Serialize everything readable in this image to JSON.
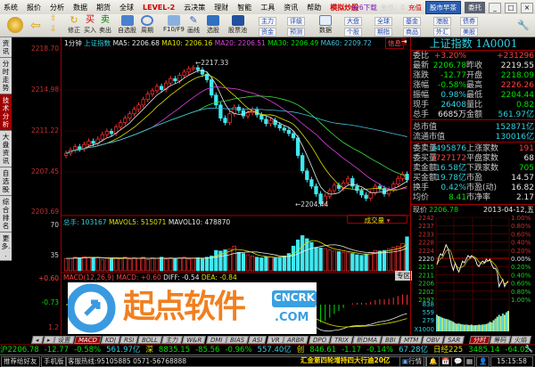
{
  "menu": {
    "items": [
      "系统",
      "报价",
      "分析",
      "数据",
      "期货",
      "全球",
      "LEVEL-2",
      "云决策",
      "理财",
      "智能",
      "工具",
      "资讯",
      "帮助",
      "模拟炒股"
    ],
    "download": "py6下载",
    "coins": "金币：0",
    "recharge": "充值",
    "morning_tea": "股市早茶",
    "entrust": "委托",
    "min": "_",
    "max": "□",
    "close": "×"
  },
  "toolbar": {
    "fix": "修正",
    "buy": "买入",
    "sell": "卖出",
    "buy_icon": "买",
    "sell_icon": "卖",
    "watchlist": "自选股",
    "period": "周期",
    "f10": "F10/F9",
    "draw": "画线",
    "pick": "选股",
    "pool": "股票池",
    "small": [
      [
        "主力",
        "资金"
      ],
      [
        "评级",
        "预测"
      ],
      [
        "大盘",
        "个股"
      ],
      [
        "全球",
        "期指"
      ],
      [
        "基金",
        "商品"
      ],
      [
        "港股",
        "外汇"
      ],
      [
        "债券",
        "美股"
      ]
    ],
    "data": "数据"
  },
  "sidebar": {
    "tabs": [
      "资讯",
      "分时走势",
      "技术分析",
      "大盘资讯",
      "自选股",
      "综合排名",
      "更多.."
    ],
    "active": 2
  },
  "chart": {
    "header": {
      "period": "1分钟",
      "name": "上证指数",
      "ma5": "MA5: 2206.68",
      "ma10": "MA10: 2206.16",
      "ma20": "MA20: 2206.51",
      "ma30": "MA30: 2206.49",
      "ma60": "MA60: 2209.72",
      "info": "信息"
    },
    "price_ticks": [
      "2218.70",
      "2214.98",
      "2211.22",
      "2207.45",
      "2203.69"
    ],
    "high_label": "2217.33",
    "low_label": "2204.44",
    "ylim": [
      2203.69,
      2218.7
    ],
    "closes": [
      2209.2,
      2209.5,
      2209.8,
      2209.6,
      2210.0,
      2210.3,
      2210.1,
      2210.5,
      2210.9,
      2211.2,
      2211.0,
      2211.6,
      2212.0,
      2212.4,
      2212.8,
      2213.2,
      2213.6,
      2214.1,
      2214.6,
      2214.9,
      2215.3,
      2215.0,
      2215.6,
      2216.0,
      2215.8,
      2216.3,
      2216.6,
      2216.9,
      2217.0,
      2216.8,
      2216.4,
      2215.9,
      2214.5,
      2213.6,
      2212.4,
      2212.0,
      2212.8,
      2213.4,
      2213.1,
      2212.6,
      2212.9,
      2213.2,
      2212.7,
      2212.3,
      2211.9,
      2212.2,
      2211.8,
      2211.5,
      2211.3,
      2211.0,
      2210.6,
      2209.0,
      2207.6,
      2206.8,
      2206.2,
      2205.5,
      2204.6,
      2205.3,
      2205.8,
      2206.3,
      2206.0,
      2206.5,
      2206.9,
      2206.2,
      2205.8,
      2205.4,
      2205.1,
      2205.6,
      2206.2,
      2206.0,
      2205.5,
      2205.9,
      2206.4,
      2206.9,
      2207.3,
      2206.78
    ],
    "volume": {
      "header_total": "总手: 103167",
      "mavol5": "MAVOL5: 515071",
      "mavol10": "MAVOL10: 478870",
      "selector": "成交量",
      "ticks": [
        "70",
        "35"
      ],
      "ymax": 75,
      "values": [
        20,
        20,
        22,
        21,
        23,
        22,
        21,
        22,
        18,
        20,
        19,
        21,
        20,
        22,
        19,
        21,
        20,
        22,
        18,
        21,
        20,
        22,
        19,
        21,
        20,
        21,
        22,
        19,
        20,
        21,
        20,
        22,
        24,
        33,
        32,
        34,
        35,
        40,
        30,
        28,
        26,
        24,
        22,
        21,
        23,
        22,
        21,
        22,
        24,
        28,
        40,
        50,
        57,
        52,
        46,
        38,
        37,
        36,
        34,
        32,
        31,
        30,
        29,
        28,
        26,
        25,
        27,
        30,
        33,
        32,
        33,
        35,
        38,
        40,
        44,
        55
      ]
    },
    "macd": {
      "header": "MACD(12,26,9)",
      "macd": "MACD: +0.60",
      "diff": "DIFF: -0.54",
      "dea": "DEA: -0.84",
      "ticks": [
        "+0.60",
        "-0.73",
        "1.2"
      ]
    },
    "expand": "专区",
    "colors": {
      "up": "#ff3030",
      "down": "#40e8f0",
      "ma5": "#e8e8e8",
      "ma10": "#e0e000",
      "ma20": "#e040e0",
      "ma30": "#40e040",
      "ma60": "#40c0e0"
    }
  },
  "quote": {
    "title": "上证指数 1A0001",
    "rows": [
      {
        "l": "委比",
        "v": "+3.20%",
        "vc": "r",
        "r": "+231296",
        "rc": "r"
      },
      {
        "l": "最新",
        "v": "2206.78",
        "vc": "g",
        "l2": "昨收",
        "r": "2219.55",
        "rc": "w"
      },
      {
        "l": "涨跌",
        "v": "-12.77",
        "vc": "g",
        "l2": "开盘",
        "r": "2218.09",
        "rc": "g"
      },
      {
        "l": "涨幅",
        "v": "-0.58%",
        "vc": "g",
        "l2": "最高",
        "r": "2226.26",
        "rc": "r"
      },
      {
        "l": "振幅",
        "v": "0.98%",
        "vc": "c",
        "l2": "最低",
        "r": "2204.44",
        "rc": "g"
      },
      {
        "l": "现手",
        "v": "26408",
        "vc": "c",
        "l2": "量比",
        "r": "0.82",
        "rc": "g"
      },
      {
        "l": "总手",
        "v": "6685万",
        "vc": "w",
        "l2": "金额",
        "r": "561.97亿",
        "rc": "c"
      },
      {
        "l": "总市值",
        "v": "",
        "vc": "w",
        "r": "152871亿",
        "rc": "c"
      },
      {
        "l": "流通市值",
        "v": "",
        "vc": "w",
        "r": "130016亿",
        "rc": "c"
      },
      {
        "l": "委卖量",
        "v": "3495876",
        "vc": "c",
        "l2": "上涨家数",
        "r": "191",
        "rc": "r"
      },
      {
        "l": "委买量",
        "v": "3727172",
        "vc": "r",
        "l2": "平盘家数",
        "r": "68",
        "rc": "w"
      },
      {
        "l": "卖金额",
        "v": "16.58亿",
        "vc": "c",
        "l2": "下跌家数",
        "r": "705",
        "rc": "g"
      },
      {
        "l": "买金额",
        "v": "19.78亿",
        "vc": "c",
        "l2": "市盈",
        "r": "14.57",
        "rc": "w"
      },
      {
        "l": "换手",
        "v": "0.42%",
        "vc": "c",
        "l2": "市盈(动)",
        "r": "16.82",
        "rc": "w"
      },
      {
        "l": "均价",
        "v": "8.41",
        "vc": "g",
        "l2": "市净率",
        "r": "2.17",
        "rc": "w"
      }
    ],
    "now_label": "现价",
    "now_value": "2206.78",
    "date": "2013-04-12,五"
  },
  "intraday": {
    "price_ticks": [
      "2242",
      "2237",
      "2233",
      "2228",
      "2224",
      "2220",
      "2215",
      "2211",
      "2206",
      "2202",
      "2197"
    ],
    "pct_ticks": [
      "1.00%",
      "0.80%",
      "0.60%",
      "0.40%",
      "0.20%",
      "0.00%",
      "0.20%",
      "0.40%",
      "0.60%",
      "0.80%",
      "1.00%"
    ],
    "vol_ticks": [
      "838",
      "559",
      "279",
      "X1000"
    ],
    "ylim": [
      2197,
      2242
    ],
    "prices": [
      2216,
      2220,
      2222,
      2221,
      2224,
      2227,
      2225,
      2221,
      2216,
      2213,
      2217,
      2214,
      2212,
      2215,
      2218,
      2217,
      2219,
      2221,
      2220,
      2221,
      2220,
      2219,
      2216,
      2215,
      2217,
      2218,
      2217,
      2219,
      2218,
      2219,
      2216,
      2214,
      2214,
      2212,
      2204,
      2206,
      2208,
      2204,
      2206,
      2207
    ],
    "volumes": [
      520,
      480,
      460,
      430,
      410,
      390,
      380,
      350,
      330,
      300,
      260,
      240,
      250,
      230,
      220,
      210,
      215,
      205,
      200,
      210,
      190,
      195,
      200,
      210,
      205,
      215,
      220,
      230,
      260,
      300,
      280,
      350,
      400,
      460,
      520,
      480,
      560,
      520,
      600,
      640
    ]
  },
  "bottom_tabs": {
    "settings": "设置",
    "items": [
      "MACD",
      "KDJ",
      "RSI",
      "BOLL",
      "主力",
      "W&R",
      "DMI",
      "BIAS",
      "ASI",
      "VR",
      "ARBR",
      "DPO",
      "TRIX",
      "新DMA",
      "BBI",
      "MTM",
      "OBV",
      "SAR"
    ],
    "right": [
      "分时",
      "筹码",
      "火焰"
    ]
  },
  "ticker": [
    {
      "t": "沪2206.78",
      "c": "g"
    },
    {
      "t": "-12.77",
      "c": "g"
    },
    {
      "t": "-0.58%",
      "c": "g"
    },
    {
      "t": "561.97亿",
      "c": "c"
    },
    {
      "t": "深",
      "c": "y"
    },
    {
      "t": "8835.15",
      "c": "g"
    },
    {
      "t": "-85.56",
      "c": "g"
    },
    {
      "t": "-0.96%",
      "c": "g"
    },
    {
      "t": "557.40亿",
      "c": "c"
    },
    {
      "t": "创",
      "c": "y"
    },
    {
      "t": "846.61",
      "c": "g"
    },
    {
      "t": "-1.17",
      "c": "g"
    },
    {
      "t": "-0.14%",
      "c": "g"
    },
    {
      "t": "67.28亿",
      "c": "c"
    },
    {
      "t": "日经225",
      "c": "y"
    },
    {
      "t": "3485.14",
      "c": "g"
    },
    {
      "t": "-64.02",
      "c": "g"
    },
    {
      "t": "-0.47%",
      "c": "g"
    }
  ],
  "status": {
    "recommend": "推荐给好友",
    "mobile": "手机版",
    "hotline": "客服热线:95105885 0571-56768888",
    "news": "汇金第四轮增持四大行逾20亿",
    "quotes": "行情",
    "time": "15:15:58"
  },
  "watermark": {
    "text": "起点软件",
    "badge": "CNCRK",
    "domain": ".COM"
  }
}
